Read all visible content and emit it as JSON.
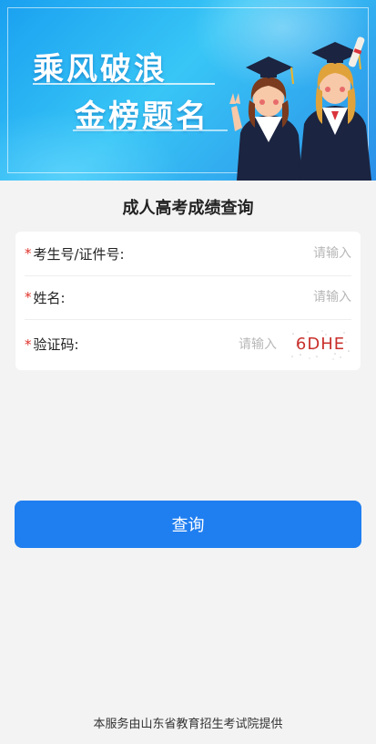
{
  "banner": {
    "slogan_line1": "乘风破浪",
    "slogan_line2": "金榜题名"
  },
  "page_title": "成人高考成绩查询",
  "form": {
    "exam_id": {
      "required_mark": "*",
      "label": "考生号/证件号:",
      "placeholder": "请输入",
      "value": ""
    },
    "name": {
      "required_mark": "*",
      "label": "姓名:",
      "placeholder": "请输入",
      "value": ""
    },
    "captcha": {
      "required_mark": "*",
      "label": "验证码:",
      "placeholder": "请输入",
      "value": "",
      "image_text": "6DHE"
    }
  },
  "query_button": "查询",
  "footer_text": "本服务由山东省教育招生考试院提供",
  "colors": {
    "primary": "#1f7ef0",
    "required": "#e0322b",
    "banner": "#2aa8f2",
    "background": "#f3f3f3"
  }
}
